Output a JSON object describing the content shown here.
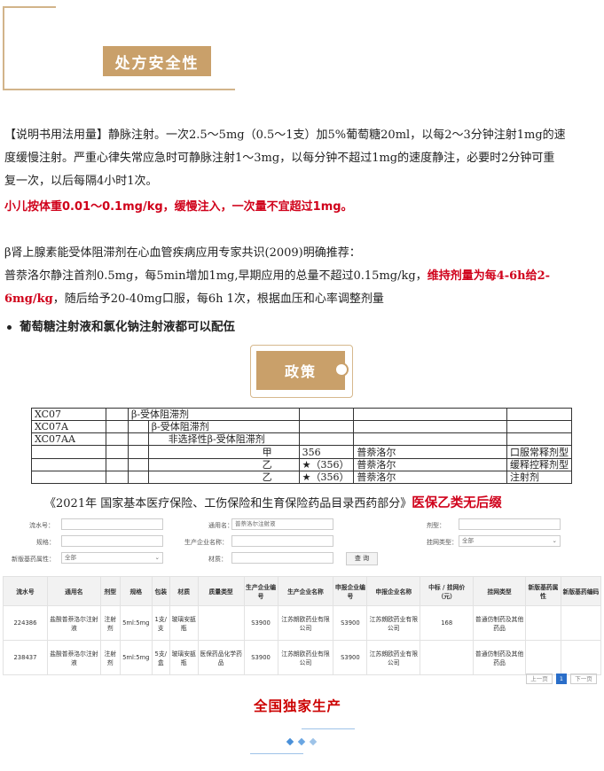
{
  "header": {
    "section_title": "处方安全性"
  },
  "dosage_block": {
    "line1": "【说明书用法用量】静脉注射。一次2.5～5mg（0.5～1支）加5%葡萄糖20ml，以每2～3分钟注射1mg的速",
    "line2": "度缓慢注射。严重心律失常应急时可静脉注射1～3mg，以每分钟不超过1mg的速度静注，必要时2分钟可重",
    "line3": "复一次，以后每隔4小时1次。",
    "pediatric": "小儿按体重0.01～0.1mg/kg，缓慢注入，一次量不宜超过1mg。"
  },
  "consensus_block": {
    "line1": "β肾上腺素能受体阻滞剂在心血管疾病应用专家共识(2009)明确推荐：",
    "line2_a": "普萘洛尔静注首剂0.5mg，每5min增加1mg,早期应用的总量不超过0.15mg/kg，",
    "line2_red": "维持剂量为每4-6h给2-",
    "line3_red": "6mg/kg",
    "line3_b": "，随后给予20-40mg口服，每6h 1次，根据血压和心率调整剂量"
  },
  "bullet": "葡萄糖注射液和氯化钠注射液都可以配伍",
  "policy_button": "政策",
  "atc_table": {
    "rows": [
      {
        "code": "XC07",
        "c2": "β-受体阻滞剂",
        "c3": "",
        "c4": "",
        "c5": "",
        "c6": ""
      },
      {
        "code": "XC07A",
        "c2": "",
        "c3": "β-受体阻滞剂",
        "c4": "",
        "c5": "",
        "c6": ""
      },
      {
        "code": "XC07AA",
        "c2": "",
        "c3": "非选择性β-受体阻滞剂",
        "c4": "",
        "c5": "",
        "c6": ""
      },
      {
        "code": "",
        "c2": "",
        "c3": "甲",
        "c4": "356",
        "c5": "普萘洛尔",
        "c6": "口服常释剂型"
      },
      {
        "code": "",
        "c2": "",
        "c3": "乙",
        "c4": "★（356）",
        "c5": "普萘洛尔",
        "c6": "缓释控释剂型"
      },
      {
        "code": "",
        "c2": "",
        "c3": "乙",
        "c4": "★（356）",
        "c5": "普萘洛尔",
        "c6": "注射剂"
      }
    ]
  },
  "caption": {
    "text": "《2021年 国家基本医疗保险、工伤保险和生育保险药品目录西药部分》",
    "red": "医保乙类无后缀"
  },
  "search_form": {
    "serial_label": "流水号：",
    "generic_label": "通用名：",
    "generic_value": "普萘洛尔注射液",
    "dosage_label": "剂型：",
    "spec_label": "规格：",
    "manufacturer_label": "生产企业名称：",
    "listing_label": "挂网类型：",
    "listing_value": "全部",
    "essential_label": "新版基药属性：",
    "essential_value": "全部",
    "material_label": "材质：",
    "query_button": "查 询"
  },
  "result_table": {
    "headers": [
      "流水号",
      "通用名",
      "剂型",
      "规格",
      "包装",
      "材质",
      "质量类型",
      "生产企业编号",
      "生产企业名称",
      "申报企业编号",
      "申报企业名称",
      "中标 / 挂网价（元）",
      "挂网类型",
      "新版基药属性",
      "新版基药编码"
    ],
    "rows": [
      [
        "224386",
        "盐酸普萘洛尔注射液",
        "注射剂",
        "5ml:5mg",
        "1支/支",
        "玻璃安瓿瓶",
        "",
        "S3900",
        "江苏朗欧药业有限公司",
        "S3900",
        "江苏朗欧药业有限公司",
        "168",
        "普通仿制药及其他药品",
        "",
        ""
      ],
      [
        "238437",
        "盐酸普萘洛尔注射液",
        "注射剂",
        "5ml:5mg",
        "5支/盒",
        "玻璃安瓿瓶",
        "医保药品化学药品",
        "S3900",
        "江苏朗欧药业有限公司",
        "S3900",
        "江苏朗欧药业有限公司",
        "",
        "普通仿制药及其他药品",
        "",
        ""
      ]
    ]
  },
  "pagination": {
    "prev": "上一页",
    "current": "1",
    "next": "下一页"
  },
  "exclusive": "全国独家生产",
  "colors": {
    "gold": "#c9a06a",
    "red": "#d0021b",
    "blue": "#2a6ec9"
  }
}
